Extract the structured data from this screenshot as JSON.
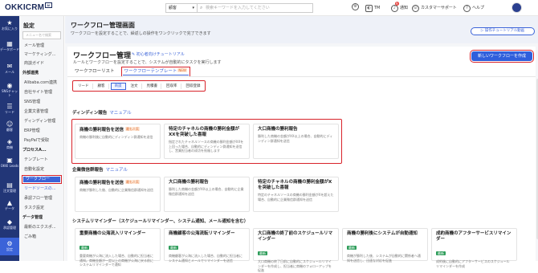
{
  "topbar": {
    "logo": "OKKICRM",
    "logo_badge": "AI",
    "select_value": "顧客",
    "search_placeholder": "検索キーワードを入力してください",
    "user": "TM",
    "notice_label": "通知",
    "notice_count": "9",
    "support": "カスタマーサポート",
    "help": "ヘルプ"
  },
  "leftnav": [
    {
      "icon": "★",
      "label": "お気に入り"
    },
    {
      "icon": "▦",
      "label": "データボード"
    },
    {
      "icon": "✉",
      "label": "メール"
    },
    {
      "icon": "◉",
      "label": "SNSチャット"
    },
    {
      "icon": "☰",
      "label": "リード"
    },
    {
      "icon": "☺",
      "label": "顧客"
    },
    {
      "icon": "◈",
      "label": "商機"
    },
    {
      "icon": "▣",
      "label": "OKKI Leads"
    },
    {
      "icon": "▤",
      "label": "注文管理"
    },
    {
      "icon": "▲",
      "label": "データ"
    },
    {
      "icon": "◆",
      "label": "承認管理"
    },
    {
      "icon": "⚙",
      "label": "設定"
    }
  ],
  "subnav": {
    "title": "設定",
    "search_placeholder": "メニュー名で検索",
    "items": [
      {
        "label": "メール管理",
        "type": "item"
      },
      {
        "label": "マーケティング...",
        "type": "item"
      },
      {
        "label": "商談ガイド",
        "type": "item"
      },
      {
        "label": "外部連携",
        "type": "group"
      },
      {
        "label": "Alibaba.com連携",
        "type": "item"
      },
      {
        "label": "自社サイト管理",
        "type": "item"
      },
      {
        "label": "SNS管理",
        "type": "item"
      },
      {
        "label": "企業文書管理",
        "type": "item"
      },
      {
        "label": "ディンディン管理",
        "type": "item"
      },
      {
        "label": "ERP管理",
        "type": "item"
      },
      {
        "label": "PayPalで受取",
        "type": "item"
      },
      {
        "label": "プロセスA...",
        "type": "group"
      },
      {
        "label": "テンプレート",
        "type": "item"
      },
      {
        "label": "自動化設定",
        "type": "item"
      },
      {
        "label": "ワークフロー",
        "type": "selected"
      },
      {
        "label": "リードソースの...",
        "type": "highlight"
      },
      {
        "label": "承認フロー管理",
        "type": "item"
      },
      {
        "label": "タスク設定",
        "type": "item"
      },
      {
        "label": "データ管理",
        "type": "group"
      },
      {
        "label": "最新のエクスポ...",
        "type": "item"
      },
      {
        "label": "ごみ箱",
        "type": "item"
      }
    ]
  },
  "page": {
    "title": "ワークフロー管理画面",
    "description": "ワークフローを設定することで、繰返しの操作をワンクリックで完了できます",
    "tutorial_button": "操作チュートリアル動画"
  },
  "workflow": {
    "title": "ワークフロー管理",
    "tutorial_link": "初心者向けチュートリアル",
    "description": "ルールとワークフローを設定することで、システムが自動的にタスクを実行します",
    "new_button": "新しいワークフローを作成",
    "tabs": [
      "ワークフローリスト",
      "ワークフローテンプレート"
    ],
    "new_tag": "NEW",
    "categories": [
      "リード",
      "顧客",
      "商談",
      "注文",
      "見積書",
      "回収率",
      "回収登録"
    ]
  },
  "sections": [
    {
      "title": "ディンディン報告",
      "manual": "マニュアル",
      "cards": [
        {
          "title": "商機の勝利報告を送信",
          "tag": "最も人気",
          "desc": "商機の勝利後に自動的にディンディン群通知を送信"
        },
        {
          "title": "特定のチャネルの商機の勝利金額がXXを突破した喜報",
          "tag": "",
          "desc": "指定されたチャネルソースの商機の勝利金額がXXを上回った場合、自動的にディンディン群通知を送信し、営業担当者の成功を祝福します"
        },
        {
          "title": "大口商機の勝利報告",
          "tag": "",
          "desc": "勝利した商機の金額がXX以上の場合、自動的にディンディン群通知を送信"
        }
      ]
    },
    {
      "title": "企業微信群報告",
      "manual": "マニュアル",
      "cards": [
        {
          "title": "商機の勝利報告を送信",
          "tag": "最も人気",
          "desc": "商機が勝利した後、自動的に企業微信群通知を送信"
        },
        {
          "title": "大口商機の勝利報告",
          "tag": "",
          "desc": "勝利した商機の金額がXX以上の場合、自動的に企業微信群通知を送信"
        },
        {
          "title": "特定のチャネルの商機の勝利金額がXを突破した喜報",
          "tag": "",
          "desc": "特定のチャネルソースの商機の勝利金額がXを超えた場合、自動的に企業微信群通知を送信"
        }
      ]
    },
    {
      "title": "システムリマインダー（スケジュールリマインダー、システム通知、メール通知を含む）",
      "manual": "",
      "cards": [
        {
          "title": "重要商機の公海流入リマインダー",
          "tag": "最新",
          "desc": "重要商機が公海に流入した場合、自動的に担当者に通知。商機金額が一定以上の商機が公海に戻る前にシステムリマインダーで通知"
        },
        {
          "title": "商機顧客の公海流転リマインダー",
          "tag": "最新",
          "desc": "商機顧客が公海に流入した場合、自動的に担当者にシステム通知とメールでリマインダーを送信"
        },
        {
          "title": "大口商機の終了前のスケジュールリマインダー",
          "tag": "最新",
          "desc": "大口商機の終了日前に自動的にスケジュールリマインダーを作成し、担当者に商機のフォローアップを促進"
        },
        {
          "title": "商機の勝利後にシステムが自動通知",
          "tag": "最新",
          "desc": "商機が勝利した後、システムが自動的に関係者へ通知を送信し、迅速な対応を促進"
        },
        {
          "title": "成約商機のアフターサービスリマインダー",
          "tag": "最新",
          "desc": "成約後に自動的にアフターサービスのスケジュールリマインダーを作成"
        }
      ]
    }
  ]
}
